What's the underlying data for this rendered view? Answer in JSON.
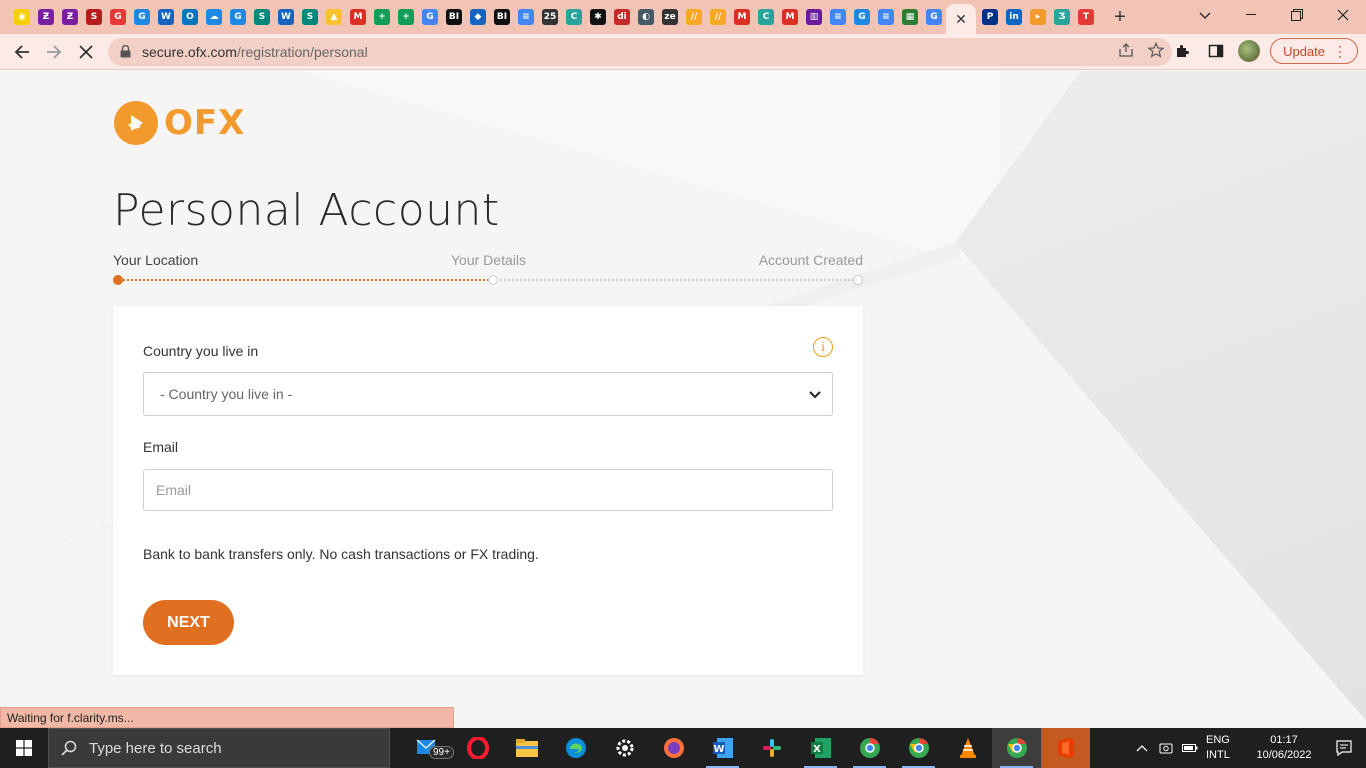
{
  "browser": {
    "tabs_favicons": [
      {
        "name": "tab-favicon-1",
        "color": "#f5d000",
        "glyph": "◉"
      },
      {
        "name": "tab-favicon-2",
        "color": "#7b1fa2",
        "glyph": "Ƶ"
      },
      {
        "name": "tab-favicon-3",
        "color": "#7b1fa2",
        "glyph": "Ƶ"
      },
      {
        "name": "tab-favicon-4",
        "color": "#b71c1c",
        "glyph": "S"
      },
      {
        "name": "tab-favicon-5",
        "color": "#e53935",
        "glyph": "G"
      },
      {
        "name": "tab-favicon-6",
        "color": "#1e88e5",
        "glyph": "G"
      },
      {
        "name": "tab-favicon-7",
        "color": "#1565c0",
        "glyph": "W"
      },
      {
        "name": "tab-favicon-8",
        "color": "#0277bd",
        "glyph": "O"
      },
      {
        "name": "tab-favicon-9",
        "color": "#1e88e5",
        "glyph": "☁"
      },
      {
        "name": "tab-favicon-10",
        "color": "#1e88e5",
        "glyph": "G"
      },
      {
        "name": "tab-favicon-11",
        "color": "#00897b",
        "glyph": "S"
      },
      {
        "name": "tab-favicon-12",
        "color": "#1565c0",
        "glyph": "W"
      },
      {
        "name": "tab-favicon-13",
        "color": "#00897b",
        "glyph": "S"
      },
      {
        "name": "tab-favicon-14",
        "color": "#fbc02d",
        "glyph": "▲"
      },
      {
        "name": "tab-favicon-15",
        "color": "#d93025",
        "glyph": "M"
      },
      {
        "name": "tab-favicon-16",
        "color": "#0f9d58",
        "glyph": "+"
      },
      {
        "name": "tab-favicon-17",
        "color": "#0f9d58",
        "glyph": "+"
      },
      {
        "name": "tab-favicon-18",
        "color": "#4285f4",
        "glyph": "G"
      },
      {
        "name": "tab-favicon-19",
        "color": "#111111",
        "glyph": "BI"
      },
      {
        "name": "tab-favicon-20",
        "color": "#1565c0",
        "glyph": "◆"
      },
      {
        "name": "tab-favicon-21",
        "color": "#111111",
        "glyph": "BI"
      },
      {
        "name": "tab-favicon-22",
        "color": "#4285f4",
        "glyph": "≡"
      },
      {
        "name": "tab-favicon-23",
        "color": "#333333",
        "glyph": "25"
      },
      {
        "name": "tab-favicon-24",
        "color": "#26a69a",
        "glyph": "C"
      },
      {
        "name": "tab-favicon-25",
        "color": "#111111",
        "glyph": "✱"
      },
      {
        "name": "tab-favicon-26",
        "color": "#c62828",
        "glyph": "di"
      },
      {
        "name": "tab-favicon-27",
        "color": "#455a64",
        "glyph": "◐"
      },
      {
        "name": "tab-favicon-28",
        "color": "#333333",
        "glyph": "ze"
      },
      {
        "name": "tab-favicon-29",
        "color": "#f9a825",
        "glyph": "//"
      },
      {
        "name": "tab-favicon-30",
        "color": "#f9a825",
        "glyph": "//"
      },
      {
        "name": "tab-favicon-31",
        "color": "#d93025",
        "glyph": "M"
      },
      {
        "name": "tab-favicon-32",
        "color": "#26a69a",
        "glyph": "C"
      },
      {
        "name": "tab-favicon-33",
        "color": "#d93025",
        "glyph": "M"
      },
      {
        "name": "tab-favicon-34",
        "color": "#6a1b9a",
        "glyph": "▥"
      },
      {
        "name": "tab-favicon-35",
        "color": "#4285f4",
        "glyph": "≡"
      },
      {
        "name": "tab-favicon-36",
        "color": "#1e88e5",
        "glyph": "G"
      },
      {
        "name": "tab-favicon-37",
        "color": "#4285f4",
        "glyph": "≡"
      },
      {
        "name": "tab-favicon-38",
        "color": "#2e7d32",
        "glyph": "▦"
      },
      {
        "name": "tab-favicon-39",
        "color": "#4285f4",
        "glyph": "G"
      }
    ],
    "tabs_favicons_after": [
      {
        "name": "tab-favicon-paypal",
        "color": "#003087",
        "glyph": "P"
      },
      {
        "name": "tab-favicon-linkedin",
        "color": "#0a66c2",
        "glyph": "in"
      },
      {
        "name": "tab-favicon-orange",
        "color": "#f39a2e",
        "glyph": "▸"
      },
      {
        "name": "tab-favicon-teal",
        "color": "#26a69a",
        "glyph": "Ʒ"
      },
      {
        "name": "tab-favicon-t",
        "color": "#e53935",
        "glyph": "T"
      }
    ],
    "active_tab_close": "✕",
    "new_tab_glyph": "+",
    "url_host": "secure.ofx.com",
    "url_path": "/registration/personal",
    "update_label": "Update",
    "status_text": "Waiting for f.clarity.ms..."
  },
  "page": {
    "logo_text": "OFX",
    "title": "Personal Account",
    "steps": [
      {
        "label": "Your Location",
        "state": "active"
      },
      {
        "label": "Your Details",
        "state": "inactive"
      },
      {
        "label": "Account Created",
        "state": "inactive"
      }
    ],
    "form": {
      "country_label": "Country you live in",
      "country_placeholder": "- Country you live in -",
      "email_label": "Email",
      "email_placeholder": "Email",
      "disclaimer": "Bank to bank transfers only. No cash transactions or FX trading.",
      "next_label": "NEXT"
    },
    "accent_color": "#e0701f"
  },
  "taskbar": {
    "search_placeholder": "Type here to search",
    "mail_badge": "99+",
    "lang_line1": "ENG",
    "lang_line2": "INTL",
    "time": "01:17",
    "date": "10/06/2022"
  }
}
